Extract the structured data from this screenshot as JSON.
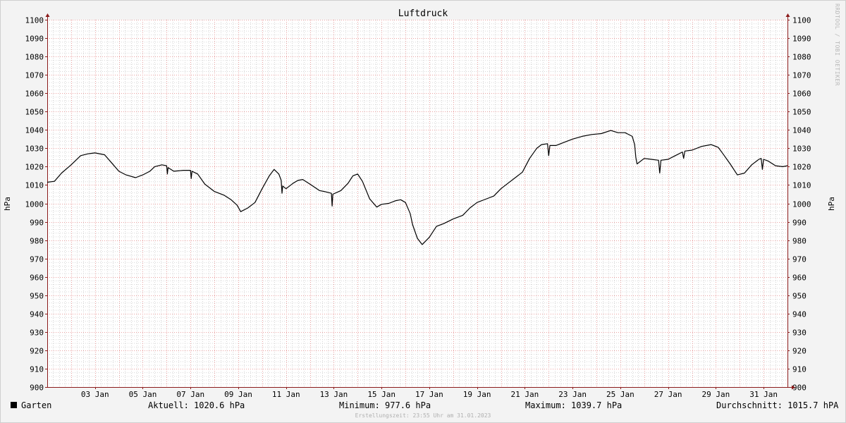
{
  "chart_data": {
    "type": "line",
    "title": "Luftdruck",
    "ylabel": "hPa",
    "ylabel_right": "hPa",
    "ylim": [
      900,
      1100
    ],
    "yticks": [
      900,
      910,
      920,
      930,
      940,
      950,
      960,
      970,
      980,
      990,
      1000,
      1010,
      1020,
      1030,
      1040,
      1050,
      1060,
      1070,
      1080,
      1090,
      1100
    ],
    "xlim": [
      1.0,
      32.0
    ],
    "xticks": [
      {
        "x": 3,
        "label": "03 Jan"
      },
      {
        "x": 5,
        "label": "05 Jan"
      },
      {
        "x": 7,
        "label": "07 Jan"
      },
      {
        "x": 9,
        "label": "09 Jan"
      },
      {
        "x": 11,
        "label": "11 Jan"
      },
      {
        "x": 13,
        "label": "13 Jan"
      },
      {
        "x": 15,
        "label": "15 Jan"
      },
      {
        "x": 17,
        "label": "17 Jan"
      },
      {
        "x": 19,
        "label": "19 Jan"
      },
      {
        "x": 21,
        "label": "21 Jan"
      },
      {
        "x": 23,
        "label": "23 Jan"
      },
      {
        "x": 25,
        "label": "25 Jan"
      },
      {
        "x": 27,
        "label": "27 Jan"
      },
      {
        "x": 29,
        "label": "29 Jan"
      },
      {
        "x": 31,
        "label": "31 Jan"
      }
    ],
    "grid": true,
    "series": [
      {
        "name": "Garten",
        "color": "#000000",
        "x": [
          1.0,
          1.3,
          1.6,
          2.0,
          2.4,
          2.7,
          3.0,
          3.4,
          3.7,
          4.0,
          4.3,
          4.7,
          5.0,
          5.3,
          5.5,
          5.8,
          6.0,
          6.03,
          6.06,
          6.3,
          6.7,
          7.0,
          7.03,
          7.06,
          7.3,
          7.6,
          8.0,
          8.4,
          8.7,
          8.95,
          9.1,
          9.4,
          9.7,
          10.0,
          10.3,
          10.5,
          10.7,
          10.8,
          10.83,
          10.86,
          11.0,
          11.3,
          11.5,
          11.7,
          12.0,
          12.4,
          12.6,
          12.9,
          12.93,
          12.96,
          13.3,
          13.6,
          13.8,
          14.0,
          14.2,
          14.5,
          14.8,
          15.0,
          15.3,
          15.6,
          15.8,
          16.0,
          16.2,
          16.3,
          16.5,
          16.7,
          17.0,
          17.3,
          17.6,
          18.0,
          18.4,
          18.7,
          19.0,
          19.4,
          19.7,
          20.0,
          20.3,
          20.6,
          20.9,
          21.2,
          21.5,
          21.7,
          21.95,
          22.0,
          22.05,
          22.3,
          22.7,
          23.0,
          23.4,
          23.8,
          24.2,
          24.6,
          24.9,
          25.2,
          25.5,
          25.6,
          25.65,
          25.7,
          26.0,
          26.3,
          26.6,
          26.65,
          26.7,
          27.0,
          27.3,
          27.6,
          27.65,
          27.7,
          28.0,
          28.4,
          28.8,
          29.1,
          29.3,
          29.6,
          29.9,
          30.2,
          30.5,
          30.8,
          30.9,
          30.95,
          31.0,
          31.2,
          31.5,
          31.8,
          32.0
        ],
        "values": [
          1011.5,
          1012.0,
          1016.5,
          1021.0,
          1026.0,
          1027.0,
          1027.5,
          1026.5,
          1022.0,
          1017.5,
          1015.5,
          1014.0,
          1015.5,
          1017.5,
          1020.0,
          1021.0,
          1020.5,
          1016.0,
          1019.5,
          1017.5,
          1018.0,
          1018.0,
          1013.5,
          1017.5,
          1016.0,
          1010.5,
          1006.5,
          1004.5,
          1002.0,
          999.0,
          995.5,
          997.5,
          1000.5,
          1008.0,
          1015.0,
          1018.5,
          1016.0,
          1012.5,
          1005.5,
          1009.5,
          1008.0,
          1011.0,
          1012.5,
          1013.0,
          1010.5,
          1007.0,
          1006.5,
          1005.5,
          998.5,
          1005.0,
          1007.0,
          1011.0,
          1015.0,
          1016.0,
          1012.0,
          1002.5,
          998.0,
          999.5,
          1000.0,
          1001.5,
          1002.0,
          1000.5,
          994.5,
          988.5,
          981.0,
          977.6,
          981.5,
          987.5,
          989.0,
          991.5,
          993.5,
          997.5,
          1000.5,
          1002.5,
          1004.0,
          1008.0,
          1011.0,
          1014.0,
          1017.0,
          1024.5,
          1030.0,
          1032.0,
          1032.5,
          1026.0,
          1031.5,
          1031.5,
          1033.5,
          1035.0,
          1036.5,
          1037.5,
          1038.0,
          1039.7,
          1038.5,
          1038.5,
          1036.5,
          1032.0,
          1025.0,
          1021.5,
          1024.5,
          1024.0,
          1023.5,
          1016.5,
          1023.5,
          1024.0,
          1026.0,
          1028.0,
          1024.5,
          1028.5,
          1029.0,
          1031.0,
          1032.0,
          1030.5,
          1027.0,
          1021.5,
          1015.5,
          1016.5,
          1021.0,
          1024.0,
          1024.5,
          1018.5,
          1024.0,
          1023.0,
          1020.5,
          1020.0,
          1020.5
        ]
      }
    ]
  },
  "legend": {
    "series_name": "Garten",
    "aktuell": "Aktuell: 1020.6 hPa",
    "minimum": "Minimum: 977.6 hPa",
    "maximum": "Maximum: 1039.7 hPa",
    "durchschnitt": "Durchschnitt: 1015.7 hPA"
  },
  "footer": "Erstellungszeit: 23:55 Uhr am 31.01.2023",
  "watermark": "RRDTOOL / TOBI OETIKER",
  "colors": {
    "background": "#f3f3f3",
    "plot_background": "#ffffff",
    "major_grid": "#e9a0a0",
    "minor_grid": "#d7d7d7",
    "axis": "#8b1a1a",
    "line": "#000000"
  }
}
